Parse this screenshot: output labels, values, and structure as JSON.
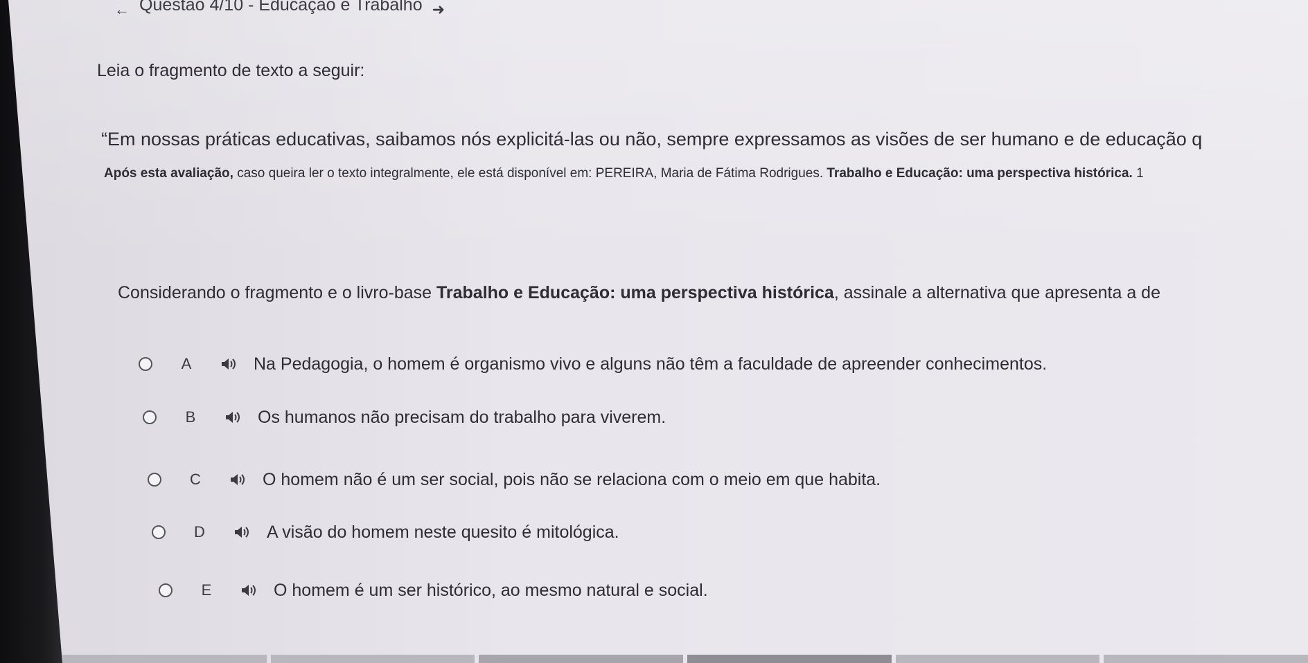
{
  "header": {
    "back_icon": "arrow-left-icon",
    "title": "Questão 4/10 - Educação e Trabalho",
    "forward_icon": "arrow-right-icon"
  },
  "intro": "Leia o fragmento de texto a seguir:",
  "quote": "“Em nossas práticas educativas, saibamos nós explicitá-las ou não, sempre expressamos as visões de ser humano e de educação q",
  "source": {
    "prefix_bold": "Após esta avaliação,",
    "middle": " caso queira ler o texto integralmente, ele está disponível em: PEREIRA, Maria de Fátima Rodrigues. ",
    "book_bold": "Trabalho e Educação: uma perspectiva histórica.",
    "suffix": " 1"
  },
  "prompt": {
    "before": "Considerando o fragmento e o livro-base ",
    "book_bold": "Trabalho e Educação: uma perspectiva histórica",
    "after": ", assinale a alternativa que apresenta a de"
  },
  "options": [
    {
      "letter": "A",
      "text": "Na Pedagogia, o homem é organismo vivo e alguns não têm a faculdade de apreender conhecimentos."
    },
    {
      "letter": "B",
      "text": "Os humanos não precisam do trabalho para viverem."
    },
    {
      "letter": "C",
      "text": "O homem não é um ser social, pois não se relaciona com o meio em que habita."
    },
    {
      "letter": "D",
      "text": "A visão do homem neste quesito é mitológica."
    },
    {
      "letter": "E",
      "text": "O homem é um ser histórico, ao mesmo natural e social."
    }
  ],
  "option_icon": "speaker-icon"
}
